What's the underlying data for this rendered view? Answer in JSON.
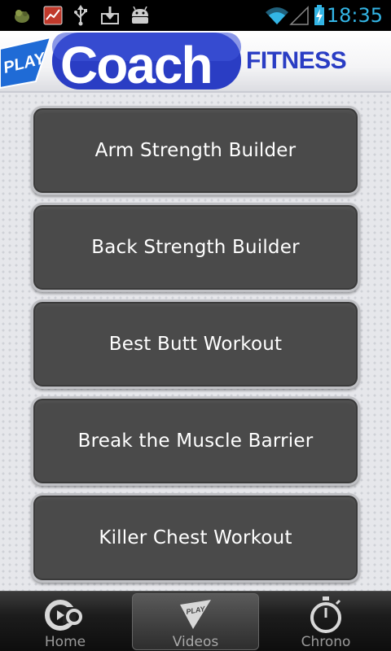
{
  "status_bar": {
    "time": "18:35",
    "icons": [
      "android-app-icon",
      "activity-monitor-icon",
      "usb-icon",
      "download-icon",
      "android-robot-icon",
      "wifi-icon",
      "signal-icon",
      "battery-charging-icon"
    ],
    "accent_color": "#33b5e5"
  },
  "header": {
    "logo_text_play": "PLAY",
    "logo_text_coach": "Coach",
    "logo_text_fitness": "FITNESS",
    "brand_color": "#2b43c8"
  },
  "menu": {
    "items": [
      {
        "label": "Arm Strength Builder"
      },
      {
        "label": "Back Strength Builder"
      },
      {
        "label": "Best Butt Workout"
      },
      {
        "label": "Break the Muscle Barrier"
      },
      {
        "label": "Killer Chest Workout"
      }
    ]
  },
  "tabbar": {
    "tabs": [
      {
        "label": "Home",
        "icon": "home-co-icon",
        "active": false
      },
      {
        "label": "Videos",
        "icon": "play-icon",
        "active": true
      },
      {
        "label": "Chrono",
        "icon": "stopwatch-icon",
        "active": false
      }
    ]
  }
}
